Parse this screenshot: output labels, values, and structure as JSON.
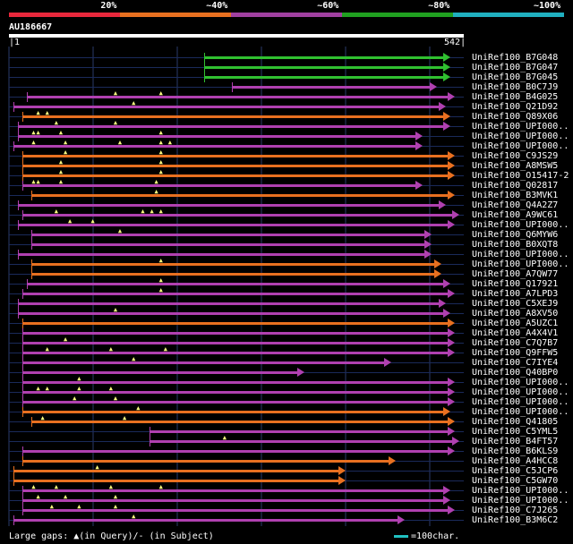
{
  "legend": [
    {
      "label": "20%",
      "color": "#e8283c"
    },
    {
      "label": "~40%",
      "color": "#e87020"
    },
    {
      "label": "~60%",
      "color": "#a040a0"
    },
    {
      "label": "~80%",
      "color": "#20a020"
    },
    {
      "label": "~100%",
      "color": "#20b0c0"
    }
  ],
  "query": {
    "title": "AU186667",
    "start": "1",
    "end": "542"
  },
  "hits": [
    {
      "label": "UniRef100_B7G048",
      "color": "#30c030",
      "start": 1,
      "end": 542,
      "s": 0.43,
      "e": 0.97,
      "gaps": []
    },
    {
      "label": "UniRef100_B7G047",
      "color": "#30c030",
      "s": 0.43,
      "e": 0.97,
      "gaps": []
    },
    {
      "label": "UniRef100_B7G045",
      "color": "#30c030",
      "s": 0.43,
      "e": 0.97,
      "gaps": []
    },
    {
      "label": "UniRef100_B0C7J9",
      "color": "#b040b0",
      "s": 0.49,
      "e": 0.94,
      "gaps": []
    },
    {
      "label": "UniRef100_B4G025",
      "color": "#b040b0",
      "s": 0.04,
      "e": 0.98,
      "gaps": [
        0.23,
        0.33
      ]
    },
    {
      "label": "UniRef100_Q21D92",
      "color": "#b040b0",
      "s": 0.01,
      "e": 0.96,
      "gaps": [
        0.27
      ]
    },
    {
      "label": "UniRef100_Q89X06",
      "color": "#e87020",
      "s": 0.03,
      "e": 0.97,
      "gaps": [
        0.06,
        0.08
      ]
    },
    {
      "label": "UniRef100_UPI000..",
      "color": "#b040b0",
      "s": 0.02,
      "e": 0.97,
      "gaps": [
        0.1,
        0.23
      ]
    },
    {
      "label": "UniRef100_UPI000..",
      "color": "#b040b0",
      "s": 0.02,
      "e": 0.91,
      "gaps": [
        0.05,
        0.06,
        0.11,
        0.33
      ]
    },
    {
      "label": "UniRef100_UPI000..",
      "color": "#b040b0",
      "s": 0.01,
      "e": 0.91,
      "gaps": [
        0.05,
        0.12,
        0.24,
        0.33,
        0.35
      ]
    },
    {
      "label": "UniRef100_C9JS29",
      "color": "#e87020",
      "s": 0.03,
      "e": 0.98,
      "gaps": [
        0.12,
        0.33
      ]
    },
    {
      "label": "UniRef100_A8MSW5",
      "color": "#e87020",
      "s": 0.03,
      "e": 0.98,
      "gaps": [
        0.11,
        0.33
      ]
    },
    {
      "label": "UniRef100_O15417-2",
      "color": "#e87020",
      "s": 0.03,
      "e": 0.98,
      "gaps": [
        0.11,
        0.33
      ]
    },
    {
      "label": "UniRef100_Q02817",
      "color": "#b040b0",
      "s": 0.03,
      "e": 0.91,
      "gaps": [
        0.05,
        0.06,
        0.11,
        0.32
      ]
    },
    {
      "label": "UniRef100_B3MVK1",
      "color": "#e87020",
      "s": 0.05,
      "e": 0.98,
      "gaps": [
        0.32
      ]
    },
    {
      "label": "UniRef100_Q4A2Z7",
      "color": "#b040b0",
      "s": 0.02,
      "e": 0.96,
      "gaps": []
    },
    {
      "label": "UniRef100_A9WC61",
      "color": "#b040b0",
      "s": 0.03,
      "e": 0.99,
      "gaps": [
        0.1,
        0.29,
        0.31,
        0.33
      ]
    },
    {
      "label": "UniRef100_UPI000..",
      "color": "#b040b0",
      "s": 0.02,
      "e": 0.98,
      "gaps": [
        0.13,
        0.18
      ]
    },
    {
      "label": "UniRef100_Q6MYW6",
      "color": "#b040b0",
      "s": 0.05,
      "e": 0.93,
      "gaps": [
        0.24
      ]
    },
    {
      "label": "UniRef100_B0XQT8",
      "color": "#b040b0",
      "s": 0.05,
      "e": 0.93,
      "gaps": []
    },
    {
      "label": "UniRef100_UPI000..",
      "color": "#b040b0",
      "s": 0.02,
      "e": 0.93,
      "gaps": []
    },
    {
      "label": "UniRef100_UPI000..",
      "color": "#e87020",
      "s": 0.05,
      "e": 0.95,
      "gaps": [
        0.33
      ]
    },
    {
      "label": "UniRef100_A7QW77",
      "color": "#e87020",
      "s": 0.05,
      "e": 0.95,
      "gaps": []
    },
    {
      "label": "UniRef100_Q17921",
      "color": "#b040b0",
      "s": 0.04,
      "e": 0.97,
      "gaps": [
        0.33
      ]
    },
    {
      "label": "UniRef100_A7LPD3",
      "color": "#b040b0",
      "s": 0.03,
      "e": 0.98,
      "gaps": [
        0.33
      ]
    },
    {
      "label": "UniRef100_C5XEJ9",
      "color": "#b040b0",
      "s": 0.02,
      "e": 0.96,
      "gaps": []
    },
    {
      "label": "UniRef100_A8XV50",
      "color": "#b040b0",
      "s": 0.02,
      "e": 0.97,
      "gaps": [
        0.23
      ]
    },
    {
      "label": "UniRef100_A5UZC1",
      "color": "#e87020",
      "s": 0.03,
      "e": 0.98,
      "gaps": []
    },
    {
      "label": "UniRef100_A4X4V1",
      "color": "#b040b0",
      "s": 0.03,
      "e": 0.98,
      "gaps": []
    },
    {
      "label": "UniRef100_C7Q7B7",
      "color": "#b040b0",
      "s": 0.03,
      "e": 0.98,
      "gaps": [
        0.12
      ]
    },
    {
      "label": "UniRef100_Q9FFW5",
      "color": "#b040b0",
      "s": 0.03,
      "e": 0.98,
      "gaps": [
        0.08,
        0.22,
        0.34
      ]
    },
    {
      "label": "UniRef100_C7IYE4",
      "color": "#b040b0",
      "s": 0.03,
      "e": 0.84,
      "gaps": [
        0.27
      ]
    },
    {
      "label": "UniRef100_Q40BP0",
      "color": "#b040b0",
      "s": 0.03,
      "e": 0.65,
      "gaps": []
    },
    {
      "label": "UniRef100_UPI000..",
      "color": "#b040b0",
      "s": 0.03,
      "e": 0.98,
      "gaps": [
        0.15
      ]
    },
    {
      "label": "UniRef100_UPI000..",
      "color": "#b040b0",
      "s": 0.03,
      "e": 0.98,
      "gaps": [
        0.06,
        0.08,
        0.15,
        0.22
      ]
    },
    {
      "label": "UniRef100_UPI000..",
      "color": "#b040b0",
      "s": 0.03,
      "e": 0.98,
      "gaps": [
        0.14,
        0.23
      ]
    },
    {
      "label": "UniRef100_UPI000..",
      "color": "#e87020",
      "s": 0.03,
      "e": 0.97,
      "gaps": [
        0.28
      ]
    },
    {
      "label": "UniRef100_Q41805",
      "color": "#e87020",
      "s": 0.05,
      "e": 0.98,
      "gaps": [
        0.07,
        0.25
      ]
    },
    {
      "label": "UniRef100_C5YML5",
      "color": "#b040b0",
      "s": 0.31,
      "e": 0.98,
      "gaps": []
    },
    {
      "label": "UniRef100_B4FT57",
      "color": "#b040b0",
      "s": 0.31,
      "e": 0.99,
      "gaps": [
        0.47
      ]
    },
    {
      "label": "UniRef100_B6KLS9",
      "color": "#b040b0",
      "s": 0.03,
      "e": 0.98,
      "gaps": []
    },
    {
      "label": "UniRef100_A4HCC8",
      "color": "#e87020",
      "s": 0.03,
      "e": 0.85,
      "gaps": []
    },
    {
      "label": "UniRef100_C5JCP6",
      "color": "#e87020",
      "s": 0.01,
      "e": 0.74,
      "gaps": [
        0.19
      ]
    },
    {
      "label": "UniRef100_C5GW70",
      "color": "#e87020",
      "s": 0.01,
      "e": 0.74,
      "gaps": []
    },
    {
      "label": "UniRef100_UPI000..",
      "color": "#b040b0",
      "s": 0.03,
      "e": 0.97,
      "gaps": [
        0.05,
        0.1,
        0.22,
        0.33
      ]
    },
    {
      "label": "UniRef100_UPI000..",
      "color": "#b040b0",
      "s": 0.03,
      "e": 0.97,
      "gaps": [
        0.06,
        0.12,
        0.23
      ]
    },
    {
      "label": "UniRef100_C7J265",
      "color": "#b040b0",
      "s": 0.03,
      "e": 0.98,
      "gaps": [
        0.09,
        0.15,
        0.23
      ]
    },
    {
      "label": "UniRef100_B3M6C2",
      "color": "#b040b0",
      "s": 0.01,
      "e": 0.87,
      "gaps": [
        0.27
      ]
    }
  ],
  "footer": {
    "left": "Large gaps: ▲(in Query)/- (in Subject)",
    "right": "=100char."
  }
}
